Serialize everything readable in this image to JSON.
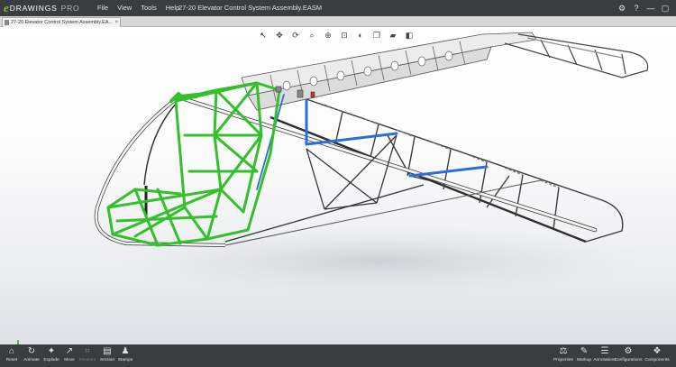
{
  "app": {
    "logo_letter": "e",
    "logo_text": "DRAWINGS",
    "logo_suffix": "PRO",
    "title": "27-20 Elevator Control System Assembly.EASM"
  },
  "menu": [
    "File",
    "View",
    "Tools",
    "Help"
  ],
  "window_controls": {
    "settings": "⚙",
    "help": "?",
    "minimize": "—",
    "maximize": "▢"
  },
  "tab": {
    "label": "27-20 Elevator Control System Assembly.EA...",
    "close": "×"
  },
  "view_toolbar": [
    {
      "name": "select",
      "glyph": "↖"
    },
    {
      "name": "pan",
      "glyph": "✥"
    },
    {
      "name": "rotate",
      "glyph": "⟳"
    },
    {
      "name": "zoom-to-fit",
      "glyph": "⌕"
    },
    {
      "name": "zoom-in",
      "glyph": "⊕"
    },
    {
      "name": "zoom-area",
      "glyph": "⊡"
    },
    {
      "name": "previous-view",
      "glyph": "◐"
    },
    {
      "name": "orientation",
      "glyph": "❒"
    },
    {
      "name": "hide-show",
      "glyph": "▰"
    },
    {
      "name": "display-style",
      "glyph": "◧"
    }
  ],
  "bottom_left": [
    {
      "label": "Reset",
      "glyph": "⌂",
      "enabled": true
    },
    {
      "label": "Animate",
      "glyph": "↻",
      "enabled": true
    },
    {
      "label": "Explode",
      "glyph": "✦",
      "enabled": true
    },
    {
      "label": "Move",
      "glyph": "↗",
      "enabled": true
    },
    {
      "label": "Measure",
      "glyph": "⌗",
      "enabled": false
    },
    {
      "label": "Section",
      "glyph": "▤",
      "enabled": true
    },
    {
      "label": "Stamps",
      "glyph": "♟",
      "enabled": true
    }
  ],
  "bottom_right": [
    {
      "label": "Properties",
      "glyph": "⚖"
    },
    {
      "label": "Markup",
      "glyph": "✎"
    },
    {
      "label": "Annotations",
      "glyph": "☰"
    },
    {
      "label": "Configurations",
      "glyph": "⚙"
    },
    {
      "label": "Components",
      "glyph": "❖"
    }
  ],
  "colors": {
    "frame_green": "#33c02a",
    "control_blue": "#2a6fd6",
    "frame_white": "#f2f2f2",
    "chrome_dark": "#3a3c3f"
  }
}
